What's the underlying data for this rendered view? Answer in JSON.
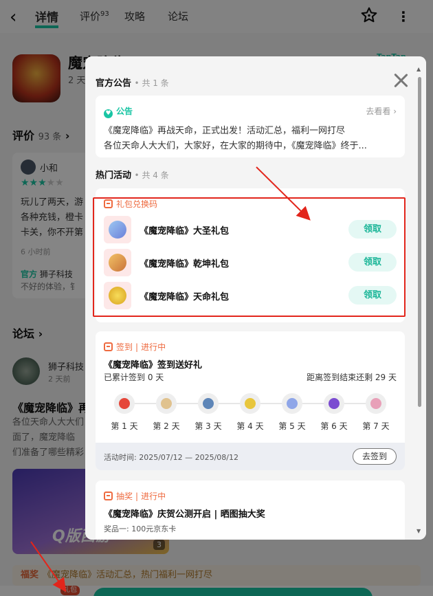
{
  "topbar": {
    "tabs": [
      {
        "label": "详情"
      },
      {
        "label": "评价",
        "badge": "93"
      },
      {
        "label": "攻略"
      },
      {
        "label": "论坛"
      }
    ]
  },
  "app": {
    "title": "魔宠降临",
    "subtitle": "2 天",
    "brand": "TapTap"
  },
  "reviews": {
    "title": "评价",
    "count": "93 条",
    "card": {
      "user": "小和",
      "rating": 3,
      "lines": [
        "玩儿了两天，游",
        "各种充钱，橙卡",
        "卡关，你不开第"
      ],
      "meta": "6 小时前",
      "official_label": "官方",
      "official_name": "狮子科技",
      "reply": "不好的体验，钅"
    }
  },
  "forum": {
    "title": "论坛",
    "post": {
      "author": "狮子科技",
      "time": "2 天前",
      "title": "《魔宠降临》再",
      "body_lines": [
        "各位天命人大大们",
        "面了，魔宠降临",
        "们准备了哪些精彩"
      ],
      "image_text": "Q版西游",
      "image_count": "3"
    }
  },
  "ticker": {
    "tag": "福奖",
    "text": "《魔宠降临》活动汇总，热门福利一网打尽"
  },
  "bottom": {
    "gift_badge": "礼包"
  },
  "modal": {
    "announcement_section": {
      "title": "官方公告",
      "count": "• 共 1 条"
    },
    "announcement": {
      "tag": "公告",
      "more": "去看看 ›",
      "line1": "《魔宠降临》再战天命，正式出发！活动汇总，福利一网打尽",
      "line2": "各位天命人大大们，大家好，在大家的期待中，《魔宠降临》终于..."
    },
    "activity_section": {
      "title": "热门活动",
      "count": "• 共 4 条"
    },
    "gift_codes": {
      "tag": "礼包兑换码",
      "items": [
        {
          "name": "《魔宠降临》大圣礼包",
          "button": "领取"
        },
        {
          "name": "《魔宠降临》乾坤礼包",
          "button": "领取"
        },
        {
          "name": "《魔宠降临》天命礼包",
          "button": "领取"
        }
      ]
    },
    "checkin": {
      "tag": "签到",
      "status": "进行中",
      "title": "《魔宠降临》签到送好礼",
      "done": "已累计签到 0 天",
      "left": "距离签到结束还剩 29 天",
      "days": [
        "第 1 天",
        "第 2 天",
        "第 3 天",
        "第 4 天",
        "第 5 天",
        "第 6 天",
        "第 7 天"
      ],
      "time": "活动时间: 2025/07/12 — 2025/08/12",
      "button": "去签到"
    },
    "lottery": {
      "tag": "抽奖",
      "status": "进行中",
      "title": "《魔宠降临》庆贺公测开启 | 晒图抽大奖",
      "prize": "奖品一: 100元京东卡"
    }
  },
  "colors": {
    "accent": "#19c5a4",
    "orange": "#ee6a3f",
    "annotation_red": "#e2251b"
  },
  "icons": [
    "back-arrow-icon",
    "star-icon",
    "more-icon",
    "close-icon",
    "heart-tag-icon",
    "gift-box-icon"
  ]
}
